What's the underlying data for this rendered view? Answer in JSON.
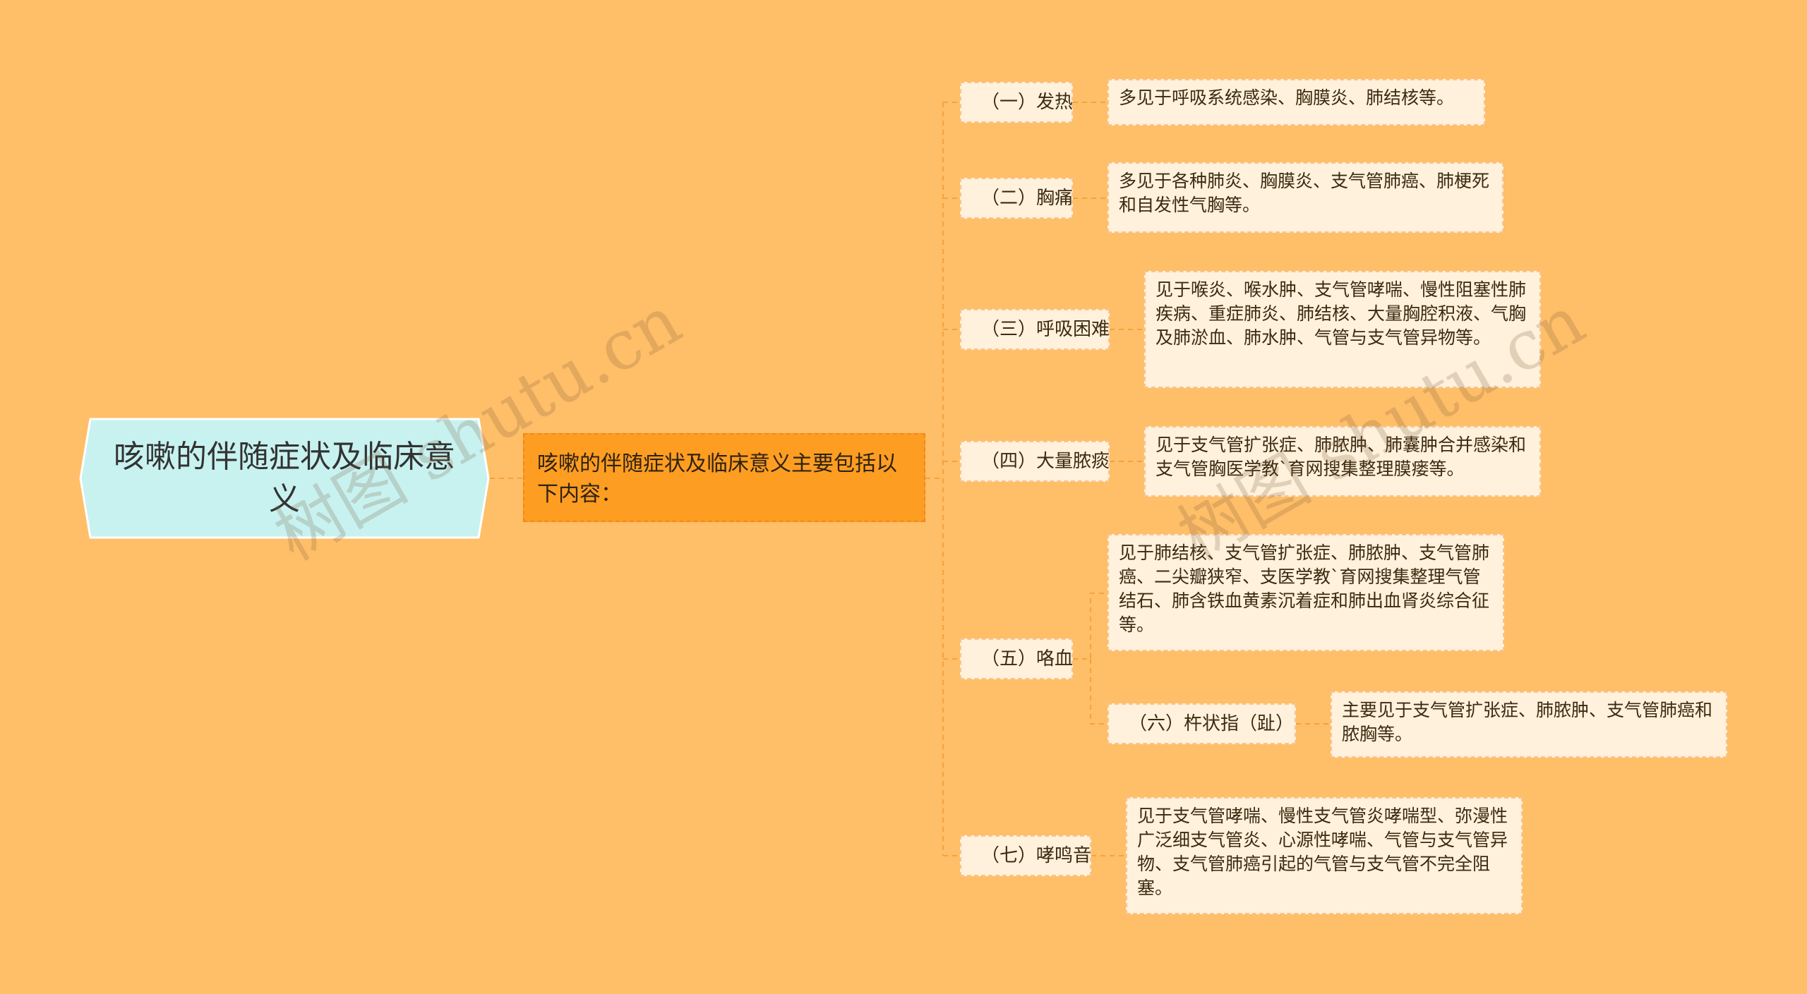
{
  "root": "咳嗽的伴随症状及临床意义",
  "summary": "咳嗽的伴随症状及临床意义主要包括以下内容：",
  "branches": [
    {
      "label": "（一）发热",
      "desc": "多见于呼吸系统感染、胸膜炎、肺结核等。"
    },
    {
      "label": "（二）胸痛",
      "desc": "多见于各种肺炎、胸膜炎、支气管肺癌、肺梗死和自发性气胸等。"
    },
    {
      "label": "（三）呼吸困难",
      "desc": "见于喉炎、喉水肿、支气管哮喘、慢性阻塞性肺疾病、重症肺炎、肺结核、大量胸腔积液、气胸及肺淤血、肺水肿、气管与支气管异物等。"
    },
    {
      "label": "（四）大量脓痰",
      "desc": "见于支气管扩张症、肺脓肿、肺囊肿合并感染和支气管胸医学教`育网搜集整理膜瘘等。"
    },
    {
      "label": "（五）咯血",
      "desc": "见于肺结核、支气管扩张症、肺脓肿、支气管肺癌、二尖瓣狭窄、支医学教`育网搜集整理气管结石、肺含铁血黄素沉着症和肺出血肾炎综合征等。"
    },
    {
      "label": "（六）杵状指（趾）",
      "desc": "主要见于支气管扩张症、肺脓肿、支气管肺癌和脓胸等。"
    },
    {
      "label": "（七）哮鸣音",
      "desc": "见于支气管哮喘、慢性支气管炎哮喘型、弥漫性广泛细支气管炎、心源性哮喘、气管与支气管异物、支气管肺癌引起的气管与支气管不完全阻塞。"
    }
  ],
  "watermark": "树图 shutu.cn",
  "colors": {
    "background": "#ffbe68",
    "root_fill": "#c8f2f0",
    "summary_fill": "#fd9d22",
    "card_fill": "#fff1dc",
    "line": "#f3a33a"
  }
}
